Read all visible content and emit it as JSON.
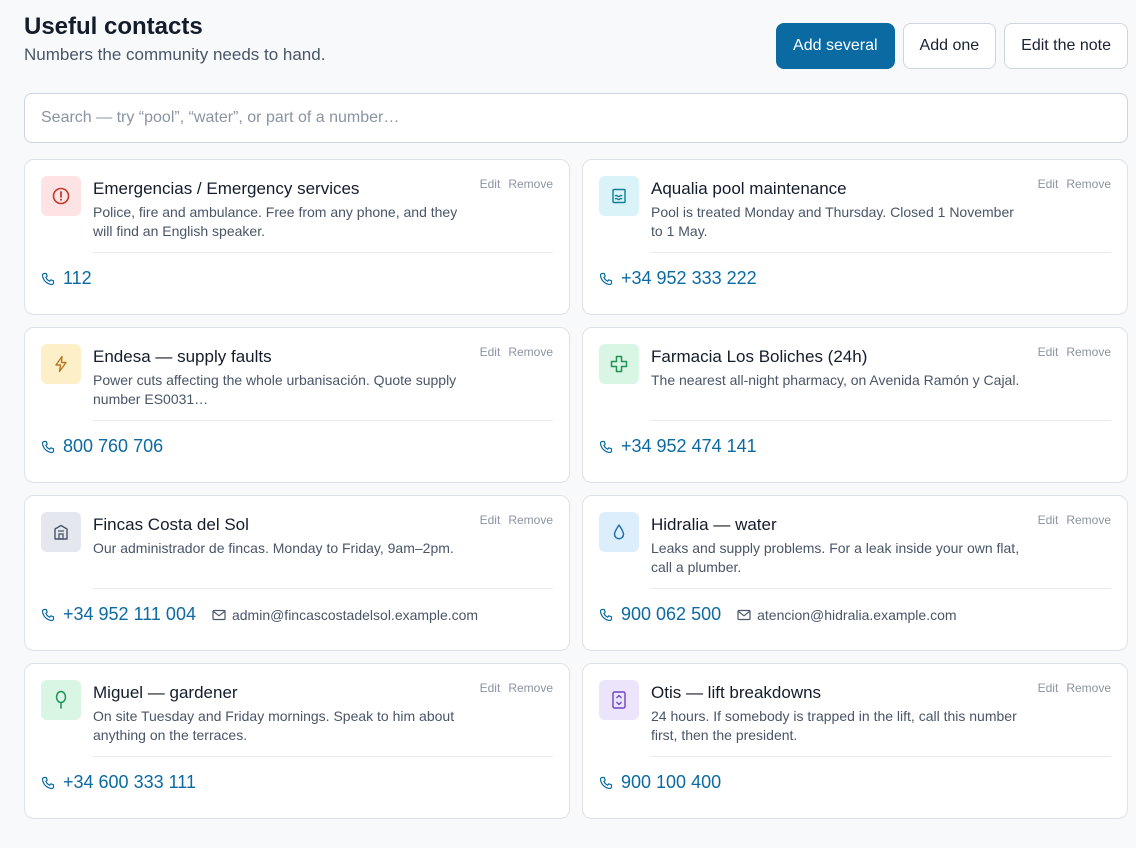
{
  "header": {
    "title": "Useful contacts",
    "subtitle": "Numbers the community needs to hand.",
    "buttons": {
      "add_several": "Add several",
      "add_one": "Add one",
      "edit_note": "Edit the note"
    }
  },
  "search": {
    "placeholder": "Search — try “pool”, “water”, or part of a number…"
  },
  "card_actions": {
    "edit": "Edit",
    "remove": "Remove"
  },
  "contacts": [
    {
      "title": "Emergencias / Emergency services",
      "desc": "Police, fire and ambulance. Free from any phone, and they will find an English speaker.",
      "phone": "112",
      "email": null,
      "icon": "alert-icon",
      "icon_bg": "#fde3e3",
      "icon_color": "#c0392b"
    },
    {
      "title": "Aqualia pool maintenance",
      "desc": "Pool is treated Monday and Thursday. Closed 1 November to 1 May.",
      "phone": "+34 952 333 222",
      "email": null,
      "icon": "pool-icon",
      "icon_bg": "#d9f3f8",
      "icon_color": "#0e7f95"
    },
    {
      "title": "Endesa — supply faults",
      "desc": "Power cuts affecting the whole urbanisación. Quote supply number ES0031…",
      "phone": "800 760 706",
      "email": null,
      "icon": "lightning-icon",
      "icon_bg": "#fdf0c9",
      "icon_color": "#b7791f"
    },
    {
      "title": "Farmacia Los Boliches (24h)",
      "desc": "The nearest all-night pharmacy, on Avenida Ramón y Cajal.",
      "phone": "+34 952 474 141",
      "email": null,
      "icon": "pharmacy-cross-icon",
      "icon_bg": "#d9f5e3",
      "icon_color": "#1f9254"
    },
    {
      "title": "Fincas Costa del Sol",
      "desc": "Our administrador de fincas. Monday to Friday, 9am–2pm.",
      "phone": "+34 952 111 004",
      "email": "admin@fincascostadelsol.example.com",
      "icon": "building-icon",
      "icon_bg": "#e4e8ee",
      "icon_color": "#4a5568"
    },
    {
      "title": "Hidralia — water",
      "desc": "Leaks and supply problems. For a leak inside your own flat, call a plumber.",
      "phone": "900 062 500",
      "email": "atencion@hidralia.example.com",
      "icon": "water-drop-icon",
      "icon_bg": "#dcedfb",
      "icon_color": "#1f6fae"
    },
    {
      "title": "Miguel — gardener",
      "desc": "On site Tuesday and Friday mornings. Speak to him about anything on the terraces.",
      "phone": "+34 600 333 111",
      "email": null,
      "icon": "tree-icon",
      "icon_bg": "#d9f5e3",
      "icon_color": "#1f9254"
    },
    {
      "title": "Otis — lift breakdowns",
      "desc": "24 hours. If somebody is trapped in the lift, call this number first, then the president.",
      "phone": "900 100 400",
      "email": null,
      "icon": "lift-icon",
      "icon_bg": "#ebe4fa",
      "icon_color": "#6b46c1"
    }
  ],
  "colors": {
    "primary": "#0b6aa2",
    "link": "#0b6aa2",
    "border": "#dde2e9"
  }
}
